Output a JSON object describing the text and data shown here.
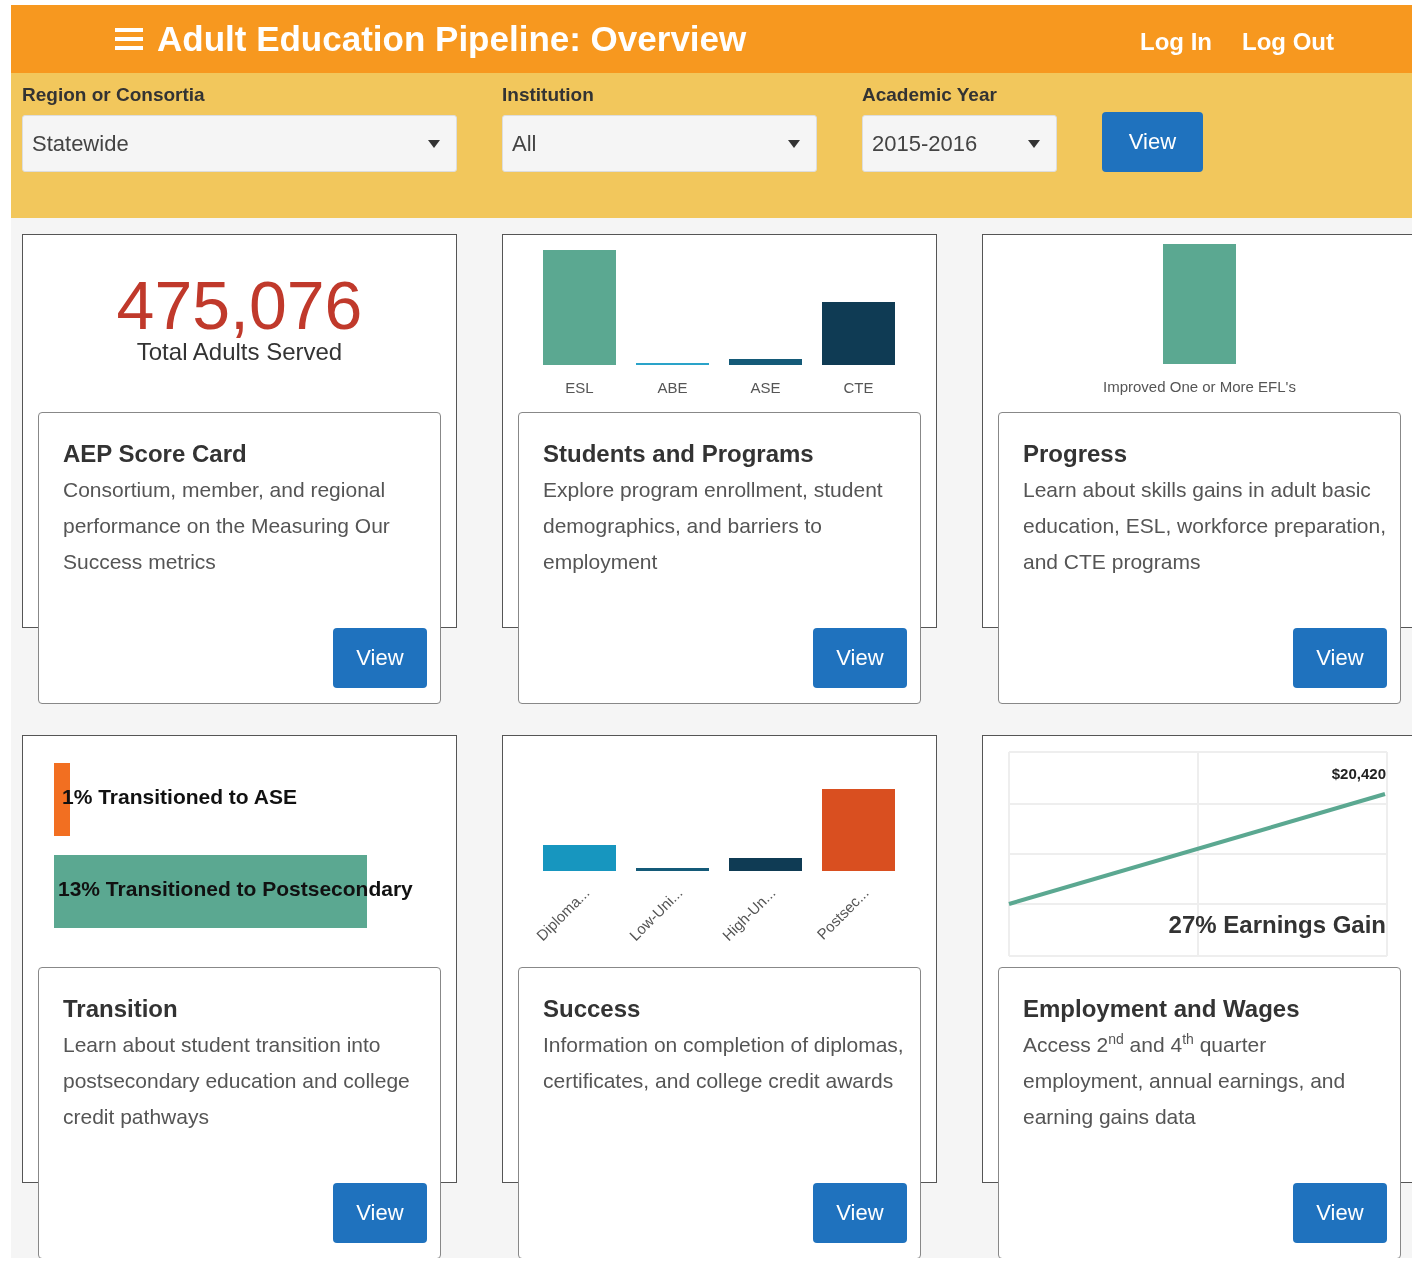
{
  "header": {
    "title": "Adult Education Pipeline: Overview",
    "links": [
      "Log In",
      "Log Out"
    ]
  },
  "filters": [
    {
      "label": "Region or Consortia",
      "value": "Statewide"
    },
    {
      "label": "Institution",
      "value": "All"
    },
    {
      "label": "Academic Year",
      "value": "2015-2016"
    }
  ],
  "filter_button": "View",
  "tiles": [
    {
      "kind": "stat",
      "stat_value": "475,076",
      "stat_caption": "Total Adults Served",
      "title": "AEP Score Card",
      "description": "Consortium, member, and regional performance on the Measuring Our Success metrics",
      "button": "View"
    },
    {
      "kind": "bars",
      "bar_labels": [
        "ESL",
        "ABE",
        "ASE",
        "CTE"
      ],
      "title": "Students and Programs",
      "description": "Explore program enrollment, student demographics, and barriers to employment",
      "button": "View"
    },
    {
      "kind": "single_bar",
      "bar_labels": [
        "Improved One or More EFL's"
      ],
      "title": "Progress",
      "description": "Learn about skills gains in adult basic education, ESL, workforce preparation, and CTE programs",
      "button": "View"
    },
    {
      "kind": "transition",
      "bar_labels": [
        "1% Transitioned to ASE",
        "13% Transitioned to Postsecondary"
      ],
      "title": "Transition",
      "description": "Learn about student transition into postsecondary education and college credit pathways",
      "button": "View"
    },
    {
      "kind": "rotated_bars",
      "bar_labels": [
        "Diploma...",
        "Low-Uni...",
        "High-Un...",
        "Postsec..."
      ],
      "title": "Success",
      "description": "Information on completion of diplomas, certificates, and college credit awards",
      "button": "View"
    },
    {
      "kind": "line",
      "line_label": "$20,420",
      "caption": "27% Earnings Gain",
      "title": "Employment and Wages",
      "description": "Access 2$^{nd}$ and 4$^{th}$ quarter employment, annual earnings, and earning gains data",
      "button": "View"
    }
  ]
}
